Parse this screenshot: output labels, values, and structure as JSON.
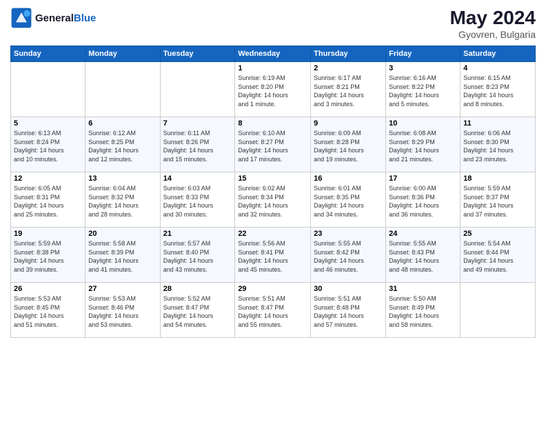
{
  "header": {
    "logo_line1": "General",
    "logo_line2": "Blue",
    "month_year": "May 2024",
    "location": "Gyovren, Bulgaria"
  },
  "weekdays": [
    "Sunday",
    "Monday",
    "Tuesday",
    "Wednesday",
    "Thursday",
    "Friday",
    "Saturday"
  ],
  "weeks": [
    [
      {
        "day": "",
        "info": ""
      },
      {
        "day": "",
        "info": ""
      },
      {
        "day": "",
        "info": ""
      },
      {
        "day": "1",
        "info": "Sunrise: 6:19 AM\nSunset: 8:20 PM\nDaylight: 14 hours\nand 1 minute."
      },
      {
        "day": "2",
        "info": "Sunrise: 6:17 AM\nSunset: 8:21 PM\nDaylight: 14 hours\nand 3 minutes."
      },
      {
        "day": "3",
        "info": "Sunrise: 6:16 AM\nSunset: 8:22 PM\nDaylight: 14 hours\nand 5 minutes."
      },
      {
        "day": "4",
        "info": "Sunrise: 6:15 AM\nSunset: 8:23 PM\nDaylight: 14 hours\nand 8 minutes."
      }
    ],
    [
      {
        "day": "5",
        "info": "Sunrise: 6:13 AM\nSunset: 8:24 PM\nDaylight: 14 hours\nand 10 minutes."
      },
      {
        "day": "6",
        "info": "Sunrise: 6:12 AM\nSunset: 8:25 PM\nDaylight: 14 hours\nand 12 minutes."
      },
      {
        "day": "7",
        "info": "Sunrise: 6:11 AM\nSunset: 8:26 PM\nDaylight: 14 hours\nand 15 minutes."
      },
      {
        "day": "8",
        "info": "Sunrise: 6:10 AM\nSunset: 8:27 PM\nDaylight: 14 hours\nand 17 minutes."
      },
      {
        "day": "9",
        "info": "Sunrise: 6:09 AM\nSunset: 8:28 PM\nDaylight: 14 hours\nand 19 minutes."
      },
      {
        "day": "10",
        "info": "Sunrise: 6:08 AM\nSunset: 8:29 PM\nDaylight: 14 hours\nand 21 minutes."
      },
      {
        "day": "11",
        "info": "Sunrise: 6:06 AM\nSunset: 8:30 PM\nDaylight: 14 hours\nand 23 minutes."
      }
    ],
    [
      {
        "day": "12",
        "info": "Sunrise: 6:05 AM\nSunset: 8:31 PM\nDaylight: 14 hours\nand 25 minutes."
      },
      {
        "day": "13",
        "info": "Sunrise: 6:04 AM\nSunset: 8:32 PM\nDaylight: 14 hours\nand 28 minutes."
      },
      {
        "day": "14",
        "info": "Sunrise: 6:03 AM\nSunset: 8:33 PM\nDaylight: 14 hours\nand 30 minutes."
      },
      {
        "day": "15",
        "info": "Sunrise: 6:02 AM\nSunset: 8:34 PM\nDaylight: 14 hours\nand 32 minutes."
      },
      {
        "day": "16",
        "info": "Sunrise: 6:01 AM\nSunset: 8:35 PM\nDaylight: 14 hours\nand 34 minutes."
      },
      {
        "day": "17",
        "info": "Sunrise: 6:00 AM\nSunset: 8:36 PM\nDaylight: 14 hours\nand 36 minutes."
      },
      {
        "day": "18",
        "info": "Sunrise: 5:59 AM\nSunset: 8:37 PM\nDaylight: 14 hours\nand 37 minutes."
      }
    ],
    [
      {
        "day": "19",
        "info": "Sunrise: 5:59 AM\nSunset: 8:38 PM\nDaylight: 14 hours\nand 39 minutes."
      },
      {
        "day": "20",
        "info": "Sunrise: 5:58 AM\nSunset: 8:39 PM\nDaylight: 14 hours\nand 41 minutes."
      },
      {
        "day": "21",
        "info": "Sunrise: 5:57 AM\nSunset: 8:40 PM\nDaylight: 14 hours\nand 43 minutes."
      },
      {
        "day": "22",
        "info": "Sunrise: 5:56 AM\nSunset: 8:41 PM\nDaylight: 14 hours\nand 45 minutes."
      },
      {
        "day": "23",
        "info": "Sunrise: 5:55 AM\nSunset: 8:42 PM\nDaylight: 14 hours\nand 46 minutes."
      },
      {
        "day": "24",
        "info": "Sunrise: 5:55 AM\nSunset: 8:43 PM\nDaylight: 14 hours\nand 48 minutes."
      },
      {
        "day": "25",
        "info": "Sunrise: 5:54 AM\nSunset: 8:44 PM\nDaylight: 14 hours\nand 49 minutes."
      }
    ],
    [
      {
        "day": "26",
        "info": "Sunrise: 5:53 AM\nSunset: 8:45 PM\nDaylight: 14 hours\nand 51 minutes."
      },
      {
        "day": "27",
        "info": "Sunrise: 5:53 AM\nSunset: 8:46 PM\nDaylight: 14 hours\nand 53 minutes."
      },
      {
        "day": "28",
        "info": "Sunrise: 5:52 AM\nSunset: 8:47 PM\nDaylight: 14 hours\nand 54 minutes."
      },
      {
        "day": "29",
        "info": "Sunrise: 5:51 AM\nSunset: 8:47 PM\nDaylight: 14 hours\nand 55 minutes."
      },
      {
        "day": "30",
        "info": "Sunrise: 5:51 AM\nSunset: 8:48 PM\nDaylight: 14 hours\nand 57 minutes."
      },
      {
        "day": "31",
        "info": "Sunrise: 5:50 AM\nSunset: 8:49 PM\nDaylight: 14 hours\nand 58 minutes."
      },
      {
        "day": "",
        "info": ""
      }
    ]
  ]
}
